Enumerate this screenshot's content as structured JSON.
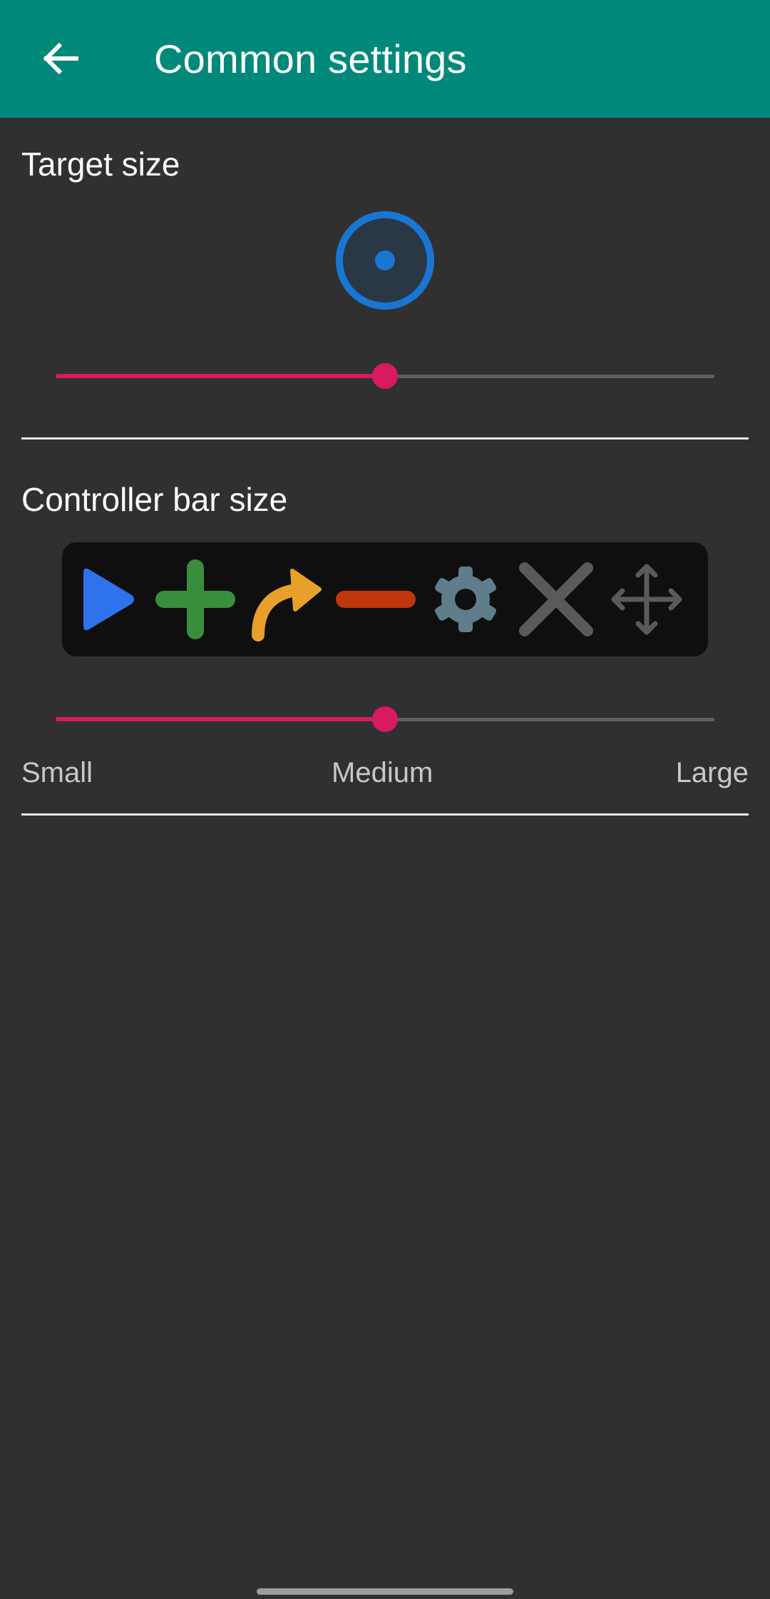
{
  "appbar": {
    "title": "Common settings",
    "back_icon": "arrow-left-icon"
  },
  "target_section": {
    "title": "Target size",
    "preview_icon": "target-circle-icon",
    "slider": {
      "value_fraction": 0.5
    }
  },
  "controller_section": {
    "title": "Controller bar size",
    "icons": [
      "play-icon",
      "plus-icon",
      "redo-arrow-icon",
      "minus-icon",
      "gear-icon",
      "close-icon",
      "move-icon"
    ],
    "slider": {
      "value_fraction": 0.5
    },
    "labels": {
      "small": "Small",
      "medium": "Medium",
      "large": "Large"
    }
  },
  "colors": {
    "appbar": "#00897B",
    "background": "#303030",
    "slider_accent": "#D81B60",
    "target_ring": "#1976D2",
    "play": "#2F73EC",
    "plus": "#388E3C",
    "redo": "#E8A02A",
    "minus": "#BF360C",
    "gear": "#607D8B",
    "close": "#5A5A5A",
    "move": "#5A5A5A"
  }
}
